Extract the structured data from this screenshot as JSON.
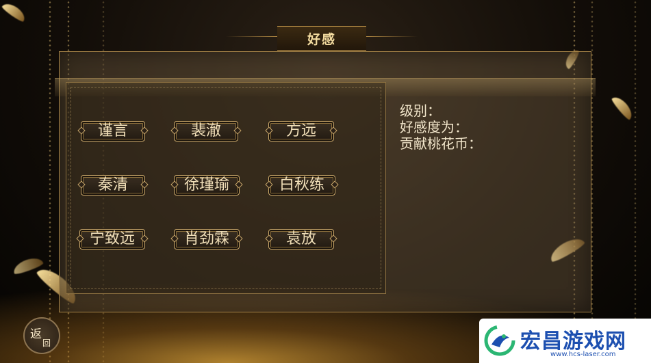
{
  "screen_title": "好感",
  "characters": [
    {
      "label": "谨言"
    },
    {
      "label": "裴澈"
    },
    {
      "label": "方远"
    },
    {
      "label": "秦清"
    },
    {
      "label": "徐瑾瑜"
    },
    {
      "label": "白秋练"
    },
    {
      "label": "宁致远"
    },
    {
      "label": "肖劲霖"
    },
    {
      "label": "袁放"
    }
  ],
  "info": {
    "level_label": "级别：",
    "affection_label": "好感度为：",
    "coins_label": "贡献桃花币："
  },
  "back_button": {
    "line1": "返",
    "line2": "回"
  },
  "watermark": {
    "title": "宏昌游戏网",
    "url": "www.hcs-laser.com"
  },
  "colors": {
    "gold_border": "#c9a76a",
    "title_text": "#f4dca0",
    "info_text": "#f3e7cc",
    "watermark_blue": "#1c4fb0"
  }
}
